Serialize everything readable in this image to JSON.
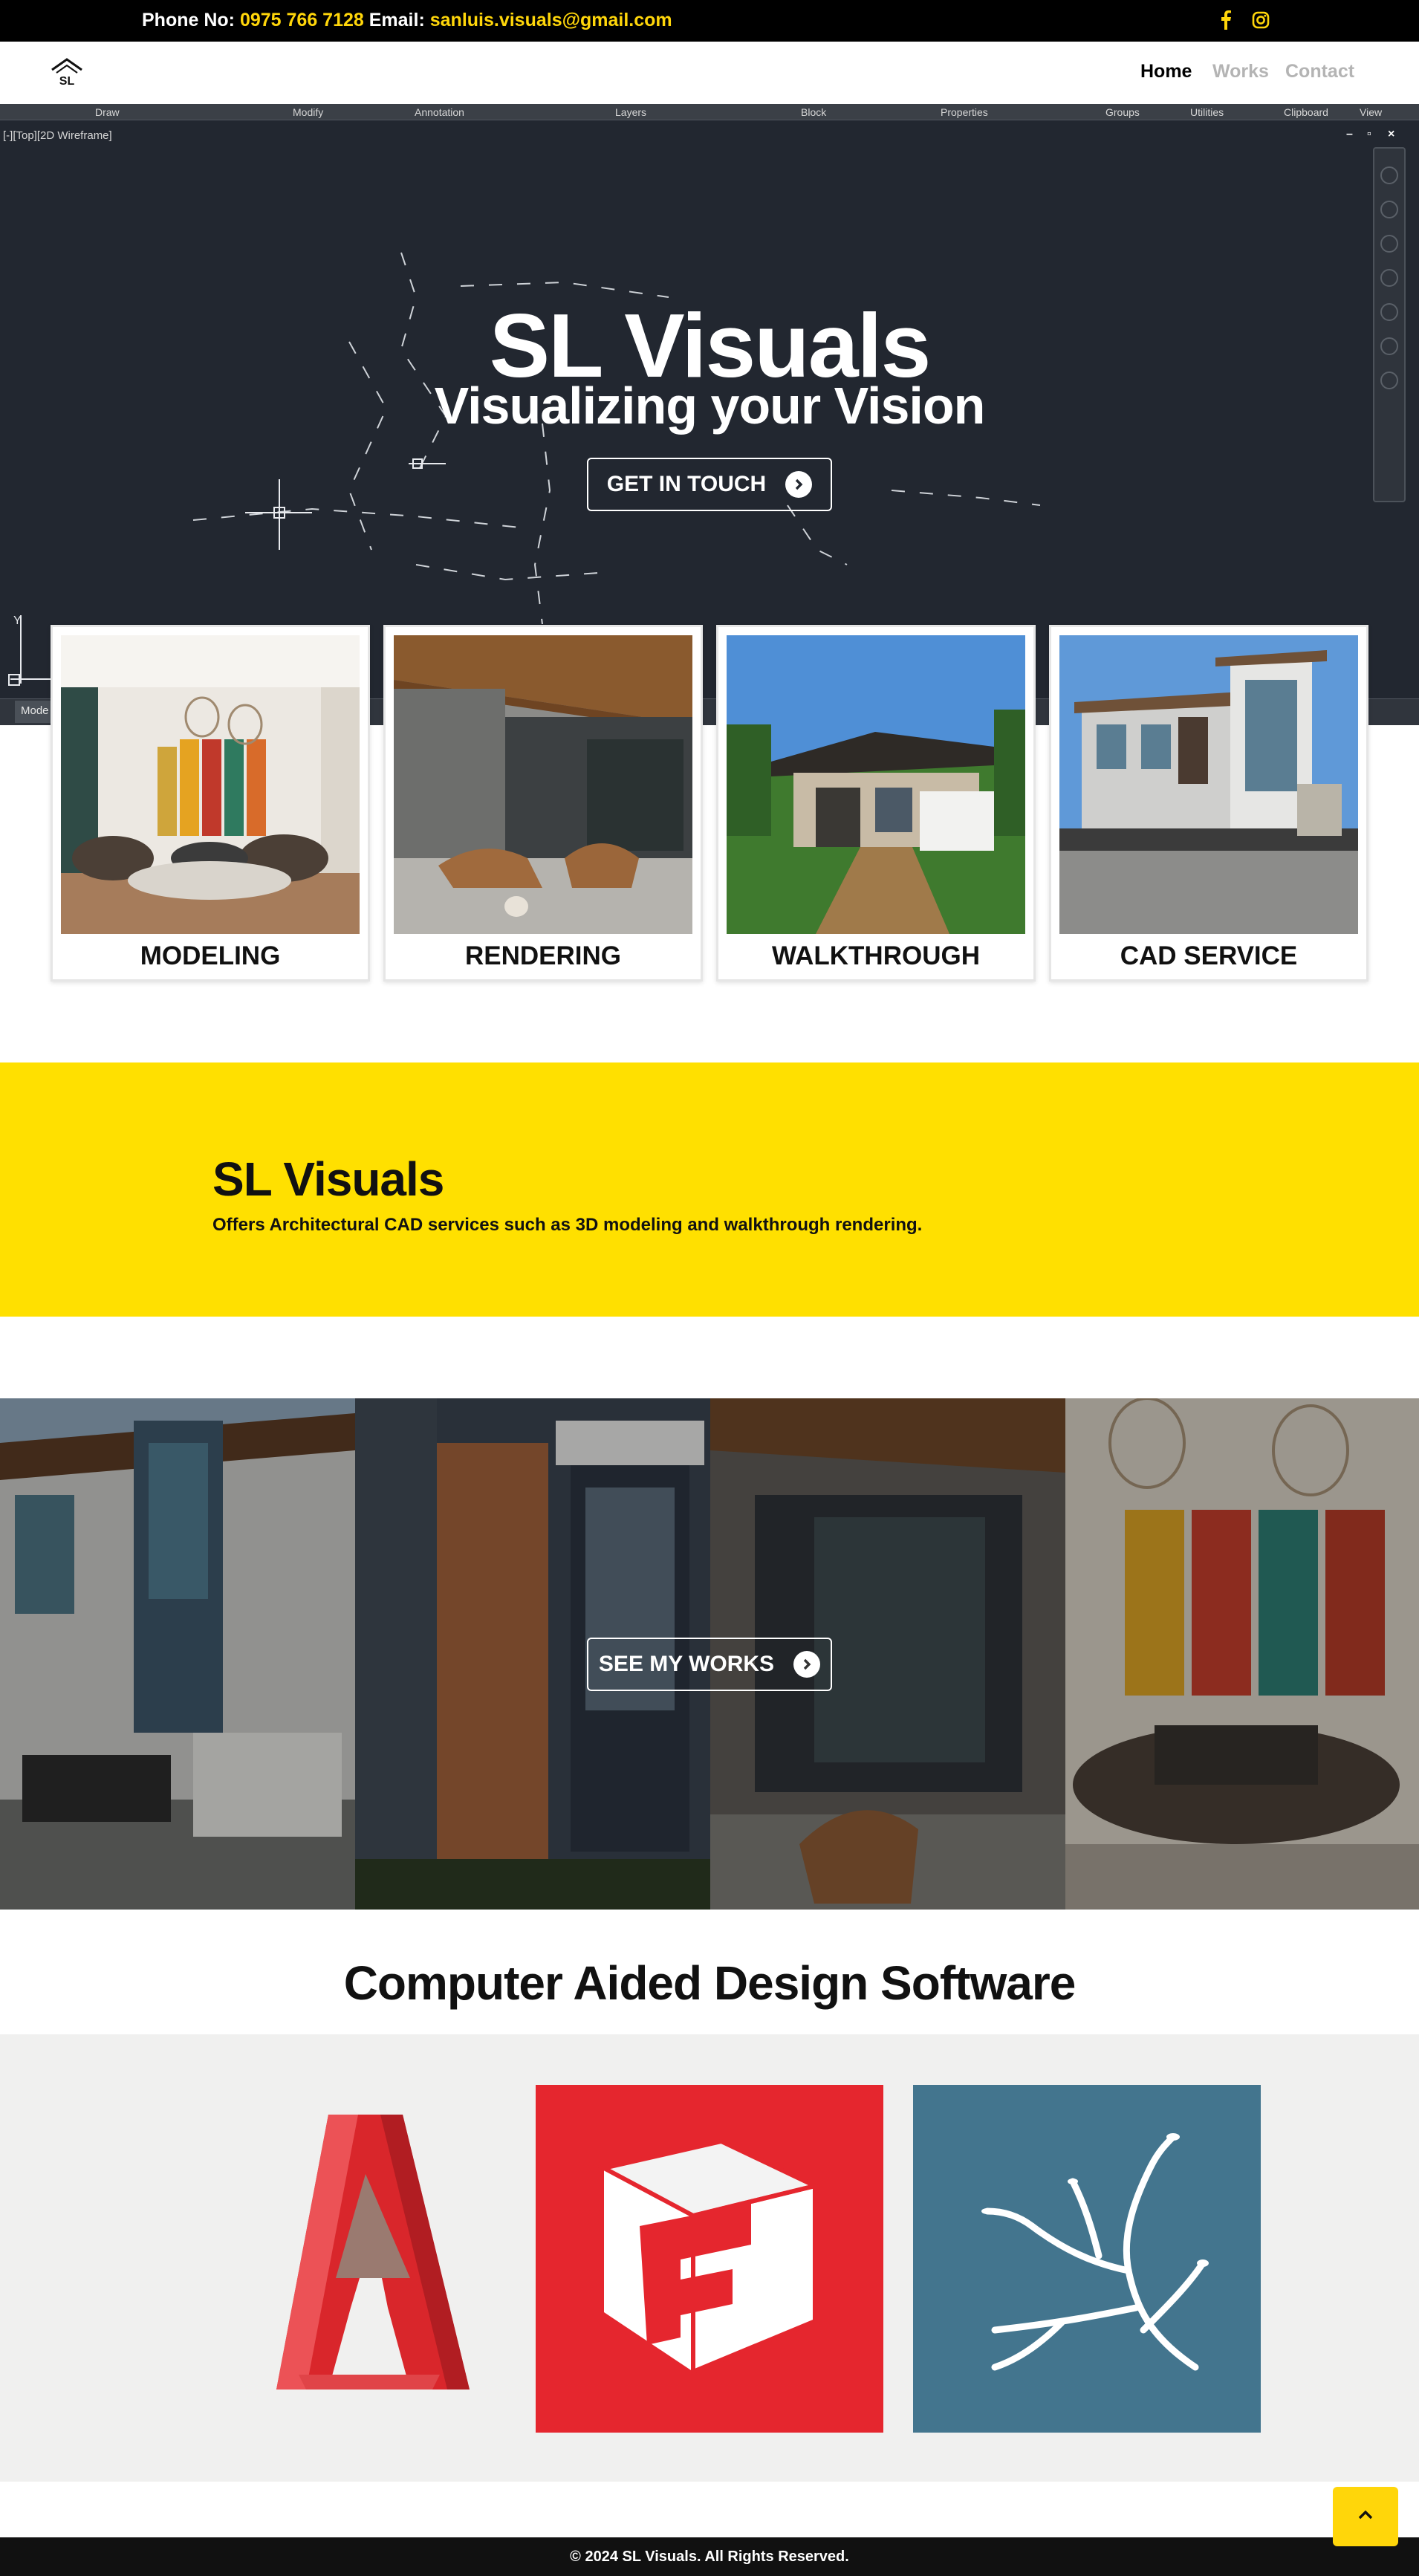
{
  "topbar": {
    "phone_label": "Phone No:",
    "phone": "0975 766 7128",
    "email_label": "Email:",
    "email": "sanluis.visuals@gmail.com",
    "icons": [
      "facebook-icon",
      "instagram-icon"
    ],
    "accent": "#ffd60a"
  },
  "nav": {
    "logo_text": "SL",
    "links": [
      "Home",
      "Works",
      "Contact"
    ],
    "active": "Home"
  },
  "cad_ui": {
    "ribbon": [
      "Draw",
      "Modify",
      "Annotation",
      "Layers",
      "Block",
      "Properties",
      "Groups",
      "Utilities",
      "Clipboard",
      "View"
    ],
    "viewport_label": "[-][Top][2D Wireframe]",
    "model_tab": "Mode"
  },
  "hero": {
    "title": "SL Visuals",
    "subtitle": "Visualizing your Vision",
    "cta": "GET IN TOUCH",
    "background": "#222730"
  },
  "services": [
    "MODELING",
    "RENDERING",
    "WALKTHROUGH",
    "CAD SERVICE"
  ],
  "about": {
    "title": "SL Visuals",
    "text": "Offers Architectural CAD services such as 3D modeling and walkthrough rendering.",
    "background": "#ffe000"
  },
  "works": {
    "cta": "SEE MY WORKS"
  },
  "software": {
    "title": "Computer Aided Design Software",
    "items": [
      "autocad-logo",
      "sketchup-logo",
      "lumion-logo"
    ]
  },
  "footer": {
    "text": "© 2024 SL Visuals. All Rights Reserved."
  }
}
